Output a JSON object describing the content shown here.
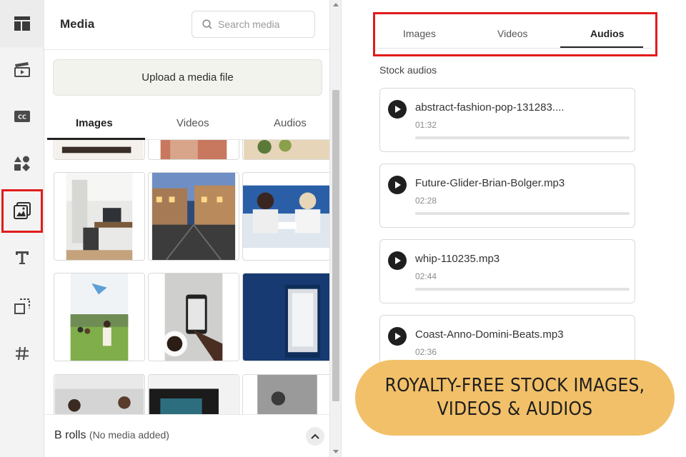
{
  "rail": {
    "items": [
      {
        "icon": "layout-icon"
      },
      {
        "icon": "clapperboard-icon"
      },
      {
        "icon": "closed-captions-icon"
      },
      {
        "icon": "shapes-icon"
      },
      {
        "icon": "media-icon"
      },
      {
        "icon": "text-icon"
      },
      {
        "icon": "crop-icon"
      },
      {
        "icon": "hashtag-icon"
      }
    ],
    "highlight_color": "#e21b1b"
  },
  "panel": {
    "title": "Media",
    "search_placeholder": "Search media",
    "upload_label": "Upload a media file",
    "tabs": [
      "Images",
      "Videos",
      "Audios"
    ],
    "active_tab": "Images",
    "brolls_title": "B rolls",
    "brolls_sub": "(No media added)"
  },
  "zoom": {
    "tabs": [
      "Images",
      "Videos",
      "Audios"
    ],
    "active_tab": "Audios",
    "section_label": "Stock audios",
    "audios": [
      {
        "name": "abstract-fashion-pop-131283....",
        "duration": "01:32"
      },
      {
        "name": "Future-Glider-Brian-Bolger.mp3",
        "duration": "02:28"
      },
      {
        "name": "whip-110235.mp3",
        "duration": "02:44"
      },
      {
        "name": "Coast-Anno-Domini-Beats.mp3",
        "duration": "02:36"
      }
    ]
  },
  "banner": {
    "line1": "ROYALTY-FREE STOCK IMAGES,",
    "line2": "VIDEOS & AUDIOS",
    "color": "#f2c068"
  }
}
